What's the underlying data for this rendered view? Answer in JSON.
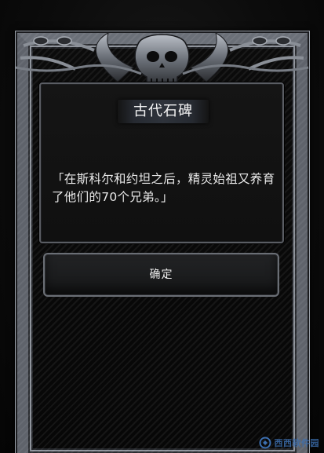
{
  "dialog": {
    "title": "古代石碑",
    "body": "「在斯科尔和约坦之后，精灵始祖又养育了他们的70个兄弟。」",
    "confirm_label": "确定"
  },
  "frame": {
    "crest_icon": "skull-crest-icon"
  },
  "watermark": {
    "text": "西西软件园",
    "logo_icon": "watermark-logo-icon"
  },
  "colors": {
    "background": "#0a0a0a",
    "frame_metal": "#6b7078",
    "text": "#f0f0f0",
    "watermark": "#3c6fb0"
  }
}
